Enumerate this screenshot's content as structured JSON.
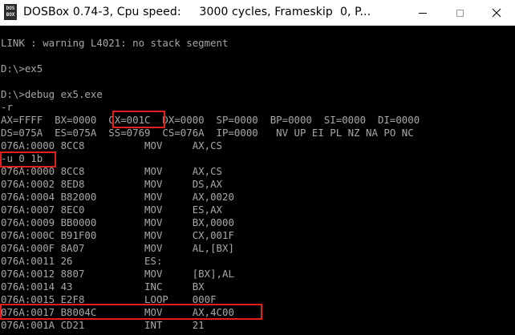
{
  "window": {
    "title": "DOSBox 0.74-3, Cpu speed:     3000 cycles, Frameskip  0, P...",
    "icon_label": "DOS BOX",
    "icons": {
      "minimize": "minimize-icon",
      "maximize": "maximize-icon",
      "close": "close-icon"
    }
  },
  "colors": {
    "terminal_bg": "#000000",
    "terminal_fg": "#a8a8a8",
    "highlight_box": "#e0201c"
  },
  "terminal": {
    "lines": [
      "LINK : warning L4021: no stack segment",
      "",
      "D:\\>ex5",
      "",
      "D:\\>debug ex5.exe",
      "-r",
      "AX=FFFF  BX=0000  CX=001C  DX=0000  SP=0000  BP=0000  SI=0000  DI=0000",
      "DS=075A  ES=075A  SS=0769  CS=076A  IP=0000   NV UP EI PL NZ NA PO NC",
      "076A:0000 8CC8          MOV     AX,CS",
      "-u 0 1b",
      "076A:0000 8CC8          MOV     AX,CS",
      "076A:0002 8ED8          MOV     DS,AX",
      "076A:0004 B82000        MOV     AX,0020",
      "076A:0007 8EC0          MOV     ES,AX",
      "076A:0009 BB0000        MOV     BX,0000",
      "076A:000C B91F00        MOV     CX,001F",
      "076A:000F 8A07          MOV     AL,[BX]",
      "076A:0011 26            ES:",
      "076A:0012 8807          MOV     [BX],AL",
      "076A:0014 43            INC     BX",
      "076A:0015 E2F8          LOOP    000F",
      "076A:0017 B8004C        MOV     AX,4C00",
      "076A:001A CD21          INT     21"
    ]
  }
}
